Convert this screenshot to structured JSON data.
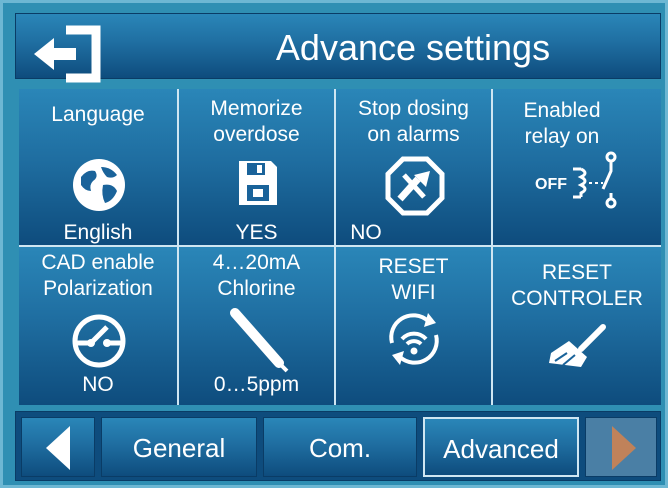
{
  "header": {
    "title": "Advance settings",
    "back_icon": "exit-arrow-icon"
  },
  "cells": [
    {
      "label1": "Language",
      "label2": "",
      "value": "English",
      "icon": "globe-icon"
    },
    {
      "label1": "Memorize",
      "label2": "overdose",
      "value": "YES",
      "icon": "floppy-disk-icon"
    },
    {
      "label1": "Stop dosing",
      "label2": "on alarms",
      "value": "NO",
      "icon": "stop-pump-icon"
    },
    {
      "label1": "Enabled",
      "label2": "relay on",
      "value": "",
      "icon": "relay-switch-icon",
      "icon_text": "OFF"
    },
    {
      "label1": "CAD enable",
      "label2": "Polarization",
      "value": "NO",
      "icon": "gauge-icon"
    },
    {
      "label1": "4…20mA",
      "label2": "Chlorine",
      "value": "0…5ppm",
      "icon": "probe-icon"
    },
    {
      "label1": "RESET",
      "label2": "WIFI",
      "value": "",
      "icon": "wifi-reset-icon"
    },
    {
      "label1": "RESET",
      "label2": "CONTROLER",
      "value": "",
      "icon": "broom-icon"
    }
  ],
  "nav": {
    "prev_icon": "left-arrow-icon",
    "next_icon": "right-arrow-icon",
    "tabs": [
      {
        "label": "General",
        "active": false
      },
      {
        "label": "Com.",
        "active": false
      },
      {
        "label": "Advanced",
        "active": true
      }
    ]
  },
  "colors": {
    "tile_top": "#2a86b8",
    "tile_bottom": "#0e4c7d",
    "frame": "#2f8fb3",
    "border": "#cfe6f2"
  }
}
